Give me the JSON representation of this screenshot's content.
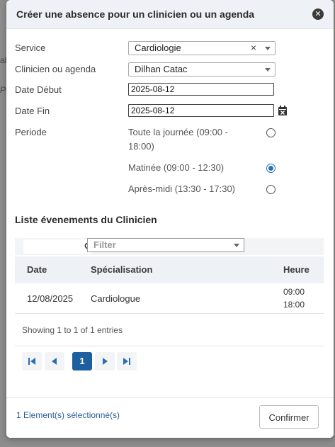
{
  "background": {
    "frag1": "ab",
    "frag2": "Pa"
  },
  "modal": {
    "title": "Créer une absence pour un clinicien ou un agenda",
    "close_label": "✕"
  },
  "form": {
    "service": {
      "label": "Service",
      "value": "Cardiologie"
    },
    "clinicien": {
      "label": "Clinicien ou agenda",
      "value": "Dilhan Catac"
    },
    "date_debut": {
      "label": "Date Début",
      "value": "2025-08-12"
    },
    "date_fin": {
      "label": "Date Fin",
      "value": "2025-08-12"
    },
    "periode": {
      "label": "Periode",
      "options": [
        {
          "label": "Toute la journée (09:00 - 18:00)",
          "selected": false
        },
        {
          "label": "Matinée (09:00 - 12:30)",
          "selected": true
        },
        {
          "label": "Après-midi (13:30 - 17:30)",
          "selected": false
        }
      ]
    }
  },
  "events": {
    "title": "Liste évenements du Clinicien",
    "filter_placeholder": "Filter",
    "columns": [
      "Date",
      "Spécialisation",
      "Heure"
    ],
    "rows": [
      {
        "date": "12/08/2025",
        "specialisation": "Cardiologue",
        "heure_start": "09:00",
        "heure_end": "18:00"
      }
    ],
    "info": "Showing 1 to 1 of 1 entries",
    "current_page": "1"
  },
  "footer": {
    "selected_info": "1 Element(s) sélectionné(s)",
    "confirm_label": "Confirmer"
  },
  "colors": {
    "accent": "#1e5fa0",
    "header_bg": "#eef1f6",
    "link": "#2a5e9a"
  }
}
